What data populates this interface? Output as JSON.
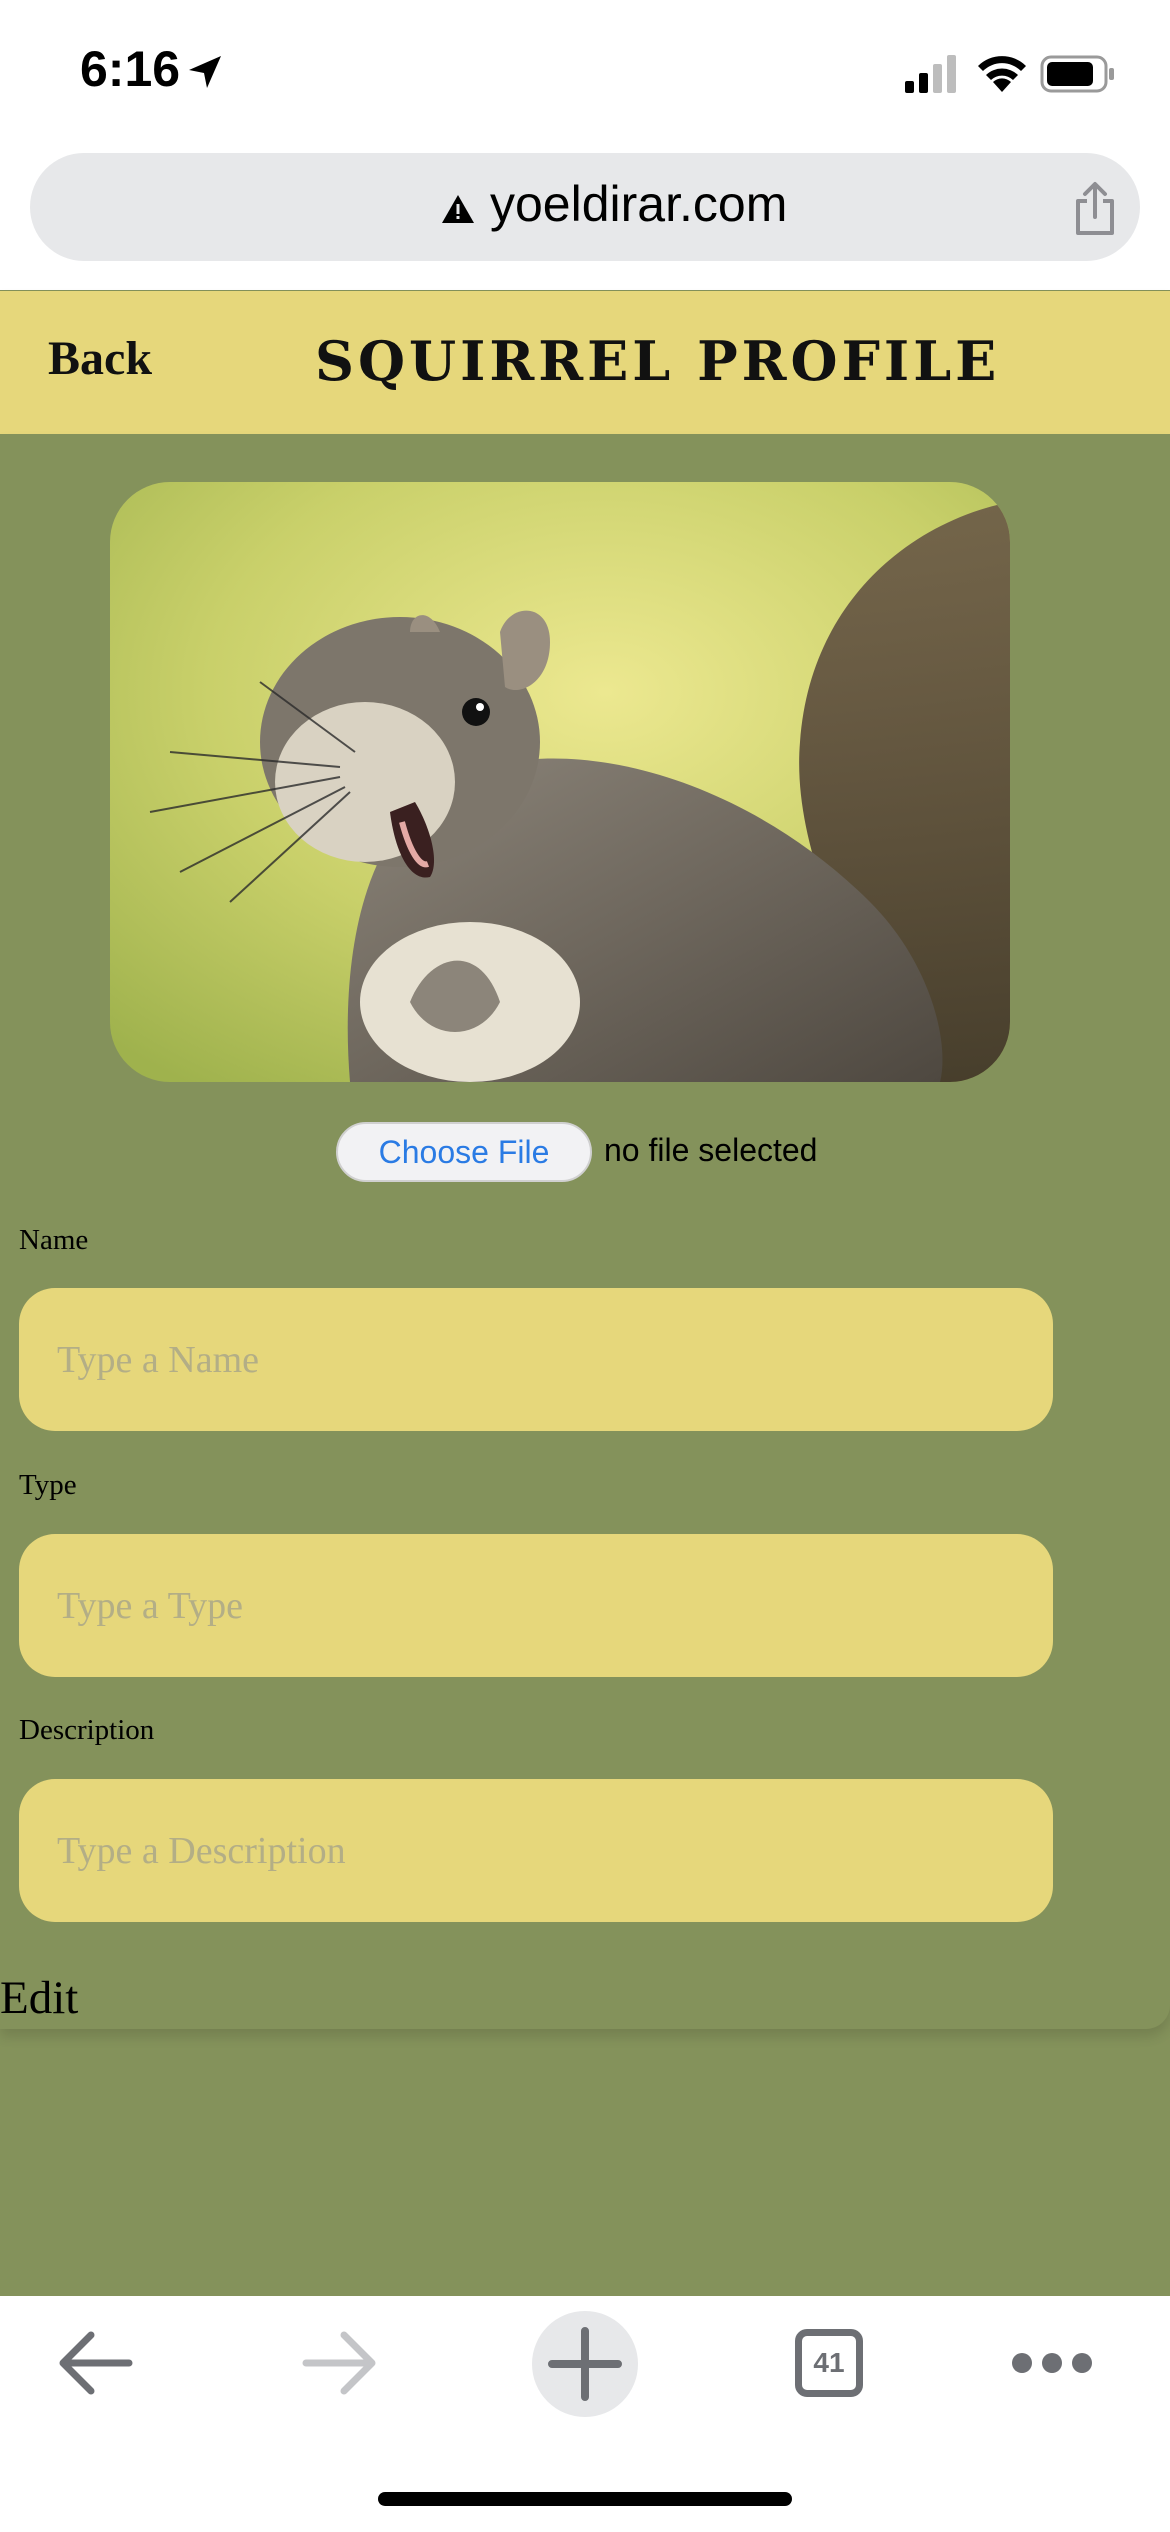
{
  "status_bar": {
    "time": "6:16"
  },
  "browser": {
    "url": "yoeldirar.com",
    "tab_count": "41"
  },
  "header": {
    "back_label": "Back",
    "title": "SQUIRREL PROFILE"
  },
  "file_picker": {
    "button_label": "Choose File",
    "status": "no file selected"
  },
  "form": {
    "name": {
      "label": "Name",
      "placeholder": "Type a Name",
      "value": ""
    },
    "type": {
      "label": "Type",
      "placeholder": "Type a Type",
      "value": ""
    },
    "description": {
      "label": "Description",
      "placeholder": "Type a Description",
      "value": ""
    }
  },
  "edit_label": "Edit",
  "colors": {
    "page_bg": "#84925b",
    "accent_yellow": "#e6d77b",
    "link_blue": "#2a7be4"
  }
}
